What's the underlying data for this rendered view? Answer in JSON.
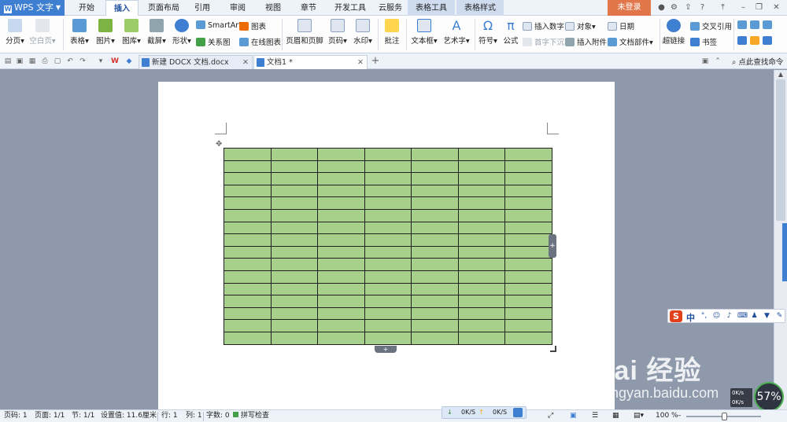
{
  "menubar": {
    "app_name": "WPS 文字",
    "tabs": [
      "开始",
      "插入",
      "页面布局",
      "引用",
      "审阅",
      "视图",
      "章节",
      "开发工具",
      "云服务",
      "表格工具",
      "表格样式"
    ],
    "active_tab": "插入",
    "login_label": "未登录"
  },
  "ribbon": {
    "page_break": "分页",
    "blank_page": "空白页",
    "table": "表格",
    "picture": "图片",
    "gallery": "图库",
    "screenshot": "截屏",
    "shapes": "形状",
    "smartart": "SmartArt",
    "relation": "关系图",
    "chart": "图表",
    "online_chart": "在线图表",
    "header_footer": "页眉和页脚",
    "page_number": "页码",
    "watermark": "水印",
    "comment": "批注",
    "textbox": "文本框",
    "wordart": "艺术字",
    "symbol": "符号",
    "formula": "公式",
    "insert_number": "插入数字",
    "object": "对象",
    "date": "日期",
    "drop_cap": "首字下沉",
    "insert_attachment": "插入附件",
    "doc_parts": "文档部件",
    "hyperlink": "超链接",
    "cross_ref": "交叉引用",
    "bookmark": "书签"
  },
  "doctabs": {
    "tabs": [
      {
        "label": "新建 DOCX 文档.docx",
        "active": false
      },
      {
        "label": "文档1 *",
        "active": true
      }
    ],
    "search_link": "点此查找命令"
  },
  "table": {
    "rows": 16,
    "cols": 7,
    "fill_color": "#a8d08d"
  },
  "ime": {
    "lang": "中"
  },
  "watermark": {
    "brand": "Bai  经验",
    "sub": "jingyan.baidu.com"
  },
  "speed_widget": {
    "percent": "57%",
    "up": "0K/s",
    "down": "0K/s"
  },
  "net": {
    "down": "0K/S",
    "up": "0K/S"
  },
  "statusbar": {
    "page_no": "页码: 1",
    "pages": "页面: 1/1",
    "section": "节: 1/1",
    "setting": "设置值: 11.6厘米",
    "row": "行: 1",
    "col": "列: 1",
    "wordcount": "字数: 0",
    "spellcheck": "拼写检查",
    "zoom": "100 %"
  }
}
